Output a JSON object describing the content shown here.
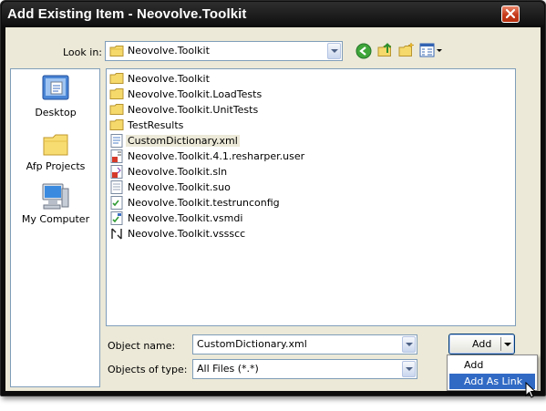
{
  "window": {
    "title": "Add Existing Item - Neovolve.Toolkit"
  },
  "look_in": {
    "label": "Look in:",
    "value": "Neovolve.Toolkit"
  },
  "places": [
    {
      "label": "Desktop",
      "icon": "desktop-icon"
    },
    {
      "label": "Afp Projects",
      "icon": "folder-icon"
    },
    {
      "label": "My Computer",
      "icon": "computer-icon"
    }
  ],
  "files": [
    {
      "name": "Neovolve.Toolkit",
      "icon": "folder-icon"
    },
    {
      "name": "Neovolve.Toolkit.LoadTests",
      "icon": "folder-icon"
    },
    {
      "name": "Neovolve.Toolkit.UnitTests",
      "icon": "folder-icon"
    },
    {
      "name": "TestResults",
      "icon": "folder-icon"
    },
    {
      "name": "CustomDictionary.xml",
      "icon": "xml-file-icon",
      "selected": true
    },
    {
      "name": "Neovolve.Toolkit.4.1.resharper.user",
      "icon": "user-file-icon"
    },
    {
      "name": "Neovolve.Toolkit.sln",
      "icon": "sln-file-icon"
    },
    {
      "name": "Neovolve.Toolkit.suo",
      "icon": "suo-file-icon"
    },
    {
      "name": "Neovolve.Toolkit.testrunconfig",
      "icon": "testrunconfig-file-icon"
    },
    {
      "name": "Neovolve.Toolkit.vsmdi",
      "icon": "vsmdi-file-icon"
    },
    {
      "name": "Neovolve.Toolkit.vssscc",
      "icon": "vssscc-file-icon"
    }
  ],
  "object_name": {
    "label": "Object name:",
    "value": "CustomDictionary.xml"
  },
  "object_type": {
    "label": "Objects of type:",
    "value": "All Files (*.*)"
  },
  "add_button": {
    "label": "Add"
  },
  "add_menu": {
    "items": [
      {
        "label": "Add",
        "highlighted": false
      },
      {
        "label": "Add As Link",
        "highlighted": true
      }
    ]
  }
}
